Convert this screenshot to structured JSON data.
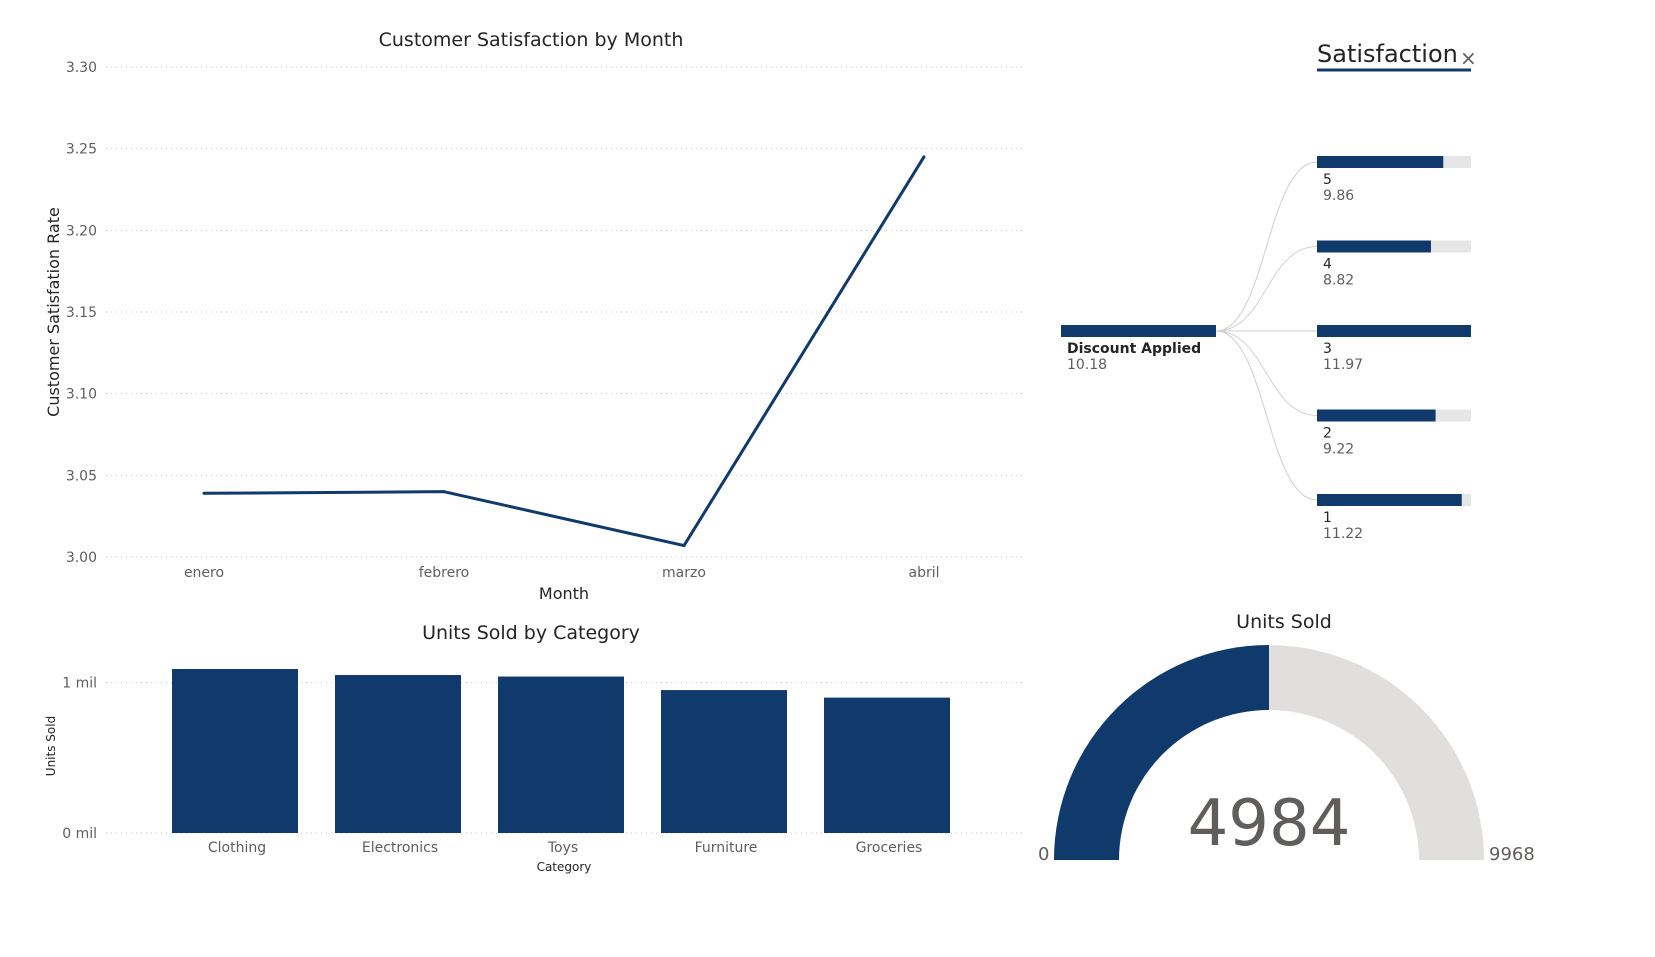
{
  "colors": {
    "primary": "#0f3a6b",
    "track": "#e6e6e6",
    "gauge_track": "#e1dfdd",
    "grid": "#c8c6c4"
  },
  "line_chart": {
    "title": "Customer Satisfaction by Month",
    "xlabel": "Month",
    "ylabel": "Customer Satisfation Rate"
  },
  "bar_chart": {
    "title": "Units Sold by Category",
    "xlabel": "Category",
    "ylabel": "Units Sold"
  },
  "decomp_tree": {
    "header": "Satisfaction",
    "close_glyph": "×",
    "root": {
      "label": "Discount Applied",
      "value": "10.18"
    },
    "children": [
      {
        "label": "5",
        "value": "9.86",
        "fraction": 0.82
      },
      {
        "label": "4",
        "value": "8.82",
        "fraction": 0.74
      },
      {
        "label": "3",
        "value": "11.97",
        "fraction": 1.0
      },
      {
        "label": "2",
        "value": "9.22",
        "fraction": 0.77
      },
      {
        "label": "1",
        "value": "11.22",
        "fraction": 0.94
      }
    ]
  },
  "gauge": {
    "title": "Units Sold",
    "value": "4984",
    "min": "0",
    "max": "9968",
    "fraction": 0.5
  },
  "chart_data": [
    {
      "type": "line",
      "title": "Customer Satisfaction by Month",
      "xlabel": "Month",
      "ylabel": "Customer Satisfation Rate",
      "categories": [
        "enero",
        "febrero",
        "marzo",
        "abril"
      ],
      "values": [
        3.039,
        3.04,
        3.007,
        3.245
      ],
      "ylim": [
        3.0,
        3.3
      ],
      "yticks": [
        3.0,
        3.05,
        3.1,
        3.15,
        3.2,
        3.25,
        3.3
      ],
      "ytick_labels": [
        "3.00",
        "3.05",
        "3.10",
        "3.15",
        "3.20",
        "3.25",
        "3.30"
      ],
      "grid": true
    },
    {
      "type": "bar",
      "title": "Units Sold by Category",
      "xlabel": "Category",
      "ylabel": "Units Sold",
      "categories": [
        "Clothing",
        "Electronics",
        "Toys",
        "Furniture",
        "Groceries"
      ],
      "values": [
        1090000,
        1050000,
        1040000,
        950000,
        900000
      ],
      "ylim": [
        0,
        1150000
      ],
      "yticks": [
        0,
        1000000
      ],
      "ytick_labels": [
        "0 mil",
        "1 mil"
      ],
      "grid": true
    }
  ]
}
